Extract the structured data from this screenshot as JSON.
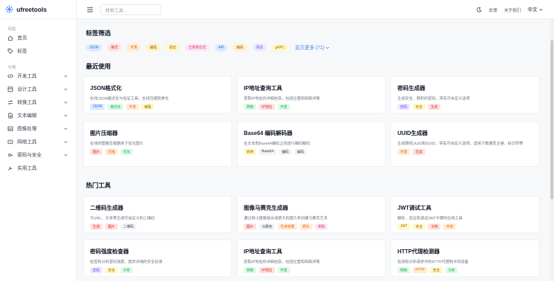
{
  "brand": {
    "name": "ufreetools"
  },
  "nav": {
    "section1_title": "导航",
    "section1_items": [
      {
        "label": "首页",
        "icon": "home-icon"
      },
      {
        "label": "标签",
        "icon": "tag-icon"
      }
    ],
    "section2_title": "分类",
    "section2_items": [
      {
        "label": "开发工具",
        "icon": "code-icon"
      },
      {
        "label": "设计工具",
        "icon": "palette-icon"
      },
      {
        "label": "转换工具",
        "icon": "swap-icon"
      },
      {
        "label": "文本编辑",
        "icon": "document-icon"
      },
      {
        "label": "图像处理",
        "icon": "image-icon"
      },
      {
        "label": "网络工具",
        "icon": "globe-icon"
      },
      {
        "label": "密码与安全",
        "icon": "shield-icon"
      },
      {
        "label": "实用工具",
        "icon": "wrench-icon"
      }
    ]
  },
  "topbar": {
    "search_placeholder": "搜索工具...",
    "feedback": "反馈",
    "about": "关于我们",
    "language": "中文"
  },
  "filter": {
    "title": "标签筛选",
    "tags": [
      {
        "label": "JSON",
        "bg": "#dbeafe",
        "fg": "#2563eb"
      },
      {
        "label": "格式",
        "bg": "#fee2e2",
        "fg": "#dc2626"
      },
      {
        "label": "开发",
        "bg": "#ffedd5",
        "fg": "#ea580c"
      },
      {
        "label": "编程",
        "bg": "#fef3c7",
        "fg": "#b45309"
      },
      {
        "label": "验证",
        "bg": "#fef9c3",
        "fg": "#a16207"
      },
      {
        "label": "正则表达式",
        "bg": "#fce7f3",
        "fg": "#db2777"
      },
      {
        "label": "API",
        "bg": "#dbeafe",
        "fg": "#2563eb"
      },
      {
        "label": "编码",
        "bg": "#fef3c7",
        "fg": "#b45309"
      },
      {
        "label": "测试",
        "bg": "#ede9fe",
        "fg": "#7c3aed"
      },
      {
        "label": "gRPC",
        "bg": "#fef9c3",
        "fg": "#a16207"
      }
    ],
    "show_more": "显示更多 (71)"
  },
  "recent": {
    "title": "最近使用",
    "cards": [
      {
        "title": "JSON格式化",
        "desc": "在线JSON格式化与验证工具，支持压缩和美化",
        "tags": [
          {
            "label": "JSON",
            "bg": "#dbeafe",
            "fg": "#2563eb"
          },
          {
            "label": "格式化",
            "bg": "#dcfce7",
            "fg": "#16a34a"
          },
          {
            "label": "开发",
            "bg": "#ffedd5",
            "fg": "#ea580c"
          },
          {
            "label": "编程",
            "bg": "#fef9c3",
            "fg": "#a16207"
          }
        ]
      },
      {
        "title": "IP地址查询工具",
        "desc": "获取IP地址的详细信息，包括位置和网络详情",
        "tags": [
          {
            "label": "网络",
            "bg": "#dcfce7",
            "fg": "#16a34a"
          },
          {
            "label": "IP地址",
            "bg": "#fee2e2",
            "fg": "#dc2626"
          },
          {
            "label": "开发",
            "bg": "#dcfce7",
            "fg": "#16a34a"
          }
        ]
      },
      {
        "title": "密码生成器",
        "desc": "生成安全、随机的密码，带有可自定义选项",
        "tags": [
          {
            "label": "密码",
            "bg": "#ede9fe",
            "fg": "#7c3aed"
          },
          {
            "label": "安全",
            "bg": "#fef9c3",
            "fg": "#a16207"
          },
          {
            "label": "生成",
            "bg": "#fee2e2",
            "fg": "#dc2626"
          }
        ]
      },
      {
        "title": "图片压缩器",
        "desc": "在线的图像压缩器用于优化图片",
        "tags": [
          {
            "label": "图片",
            "bg": "#fee2e2",
            "fg": "#dc2626"
          },
          {
            "label": "压缩",
            "bg": "#ffedd5",
            "fg": "#ea580c"
          },
          {
            "label": "优化",
            "bg": "#dcfce7",
            "fg": "#16a34a"
          }
        ]
      },
      {
        "title": "Base64 编码解码器",
        "desc": "在文本和Base64编码之间进行编码解码",
        "tags": [
          {
            "label": "转换",
            "bg": "#fef9c3",
            "fg": "#a16207"
          },
          {
            "label": "Base64",
            "bg": "#f3f4f6",
            "fg": "#374151"
          },
          {
            "label": "编码",
            "bg": "#f3f4f6",
            "fg": "#374151"
          },
          {
            "label": "解码",
            "bg": "#f3f4f6",
            "fg": "#374151"
          }
        ]
      },
      {
        "title": "UUID生成器",
        "desc": "生成随机UUID和GUID，带有可自定义选项，适用于数据库主键、标识符等",
        "tags": [
          {
            "label": "开发",
            "bg": "#ffedd5",
            "fg": "#ea580c"
          },
          {
            "label": "生成",
            "bg": "#fee2e2",
            "fg": "#dc2626"
          }
        ]
      }
    ]
  },
  "popular": {
    "title": "热门工具",
    "cards": [
      {
        "title": "二维码生成器",
        "desc": "为URL、文本等生成可自定义的二维码",
        "tags": [
          {
            "label": "生成",
            "bg": "#fee2e2",
            "fg": "#dc2626"
          },
          {
            "label": "图片",
            "bg": "#fee2e2",
            "fg": "#dc2626"
          },
          {
            "label": "二维码",
            "bg": "#f3f4f6",
            "fg": "#374151"
          }
        ]
      },
      {
        "title": "图像马赛克生成器",
        "desc": "通过将小图像组合成更大的图片来创建马赛克艺术",
        "tags": [
          {
            "label": "图片",
            "bg": "#fee2e2",
            "fg": "#dc2626"
          },
          {
            "label": "马赛克",
            "bg": "#f3f4f6",
            "fg": "#374151"
          },
          {
            "label": "艺术效果",
            "bg": "#ffedd5",
            "fg": "#ea580c"
          },
          {
            "label": "照片",
            "bg": "#ffedd5",
            "fg": "#ea580c"
          },
          {
            "label": "拼贴",
            "bg": "#fce7f3",
            "fg": "#db2777"
          }
        ]
      },
      {
        "title": "JWT调试工具",
        "desc": "解析、验证和调试JWT令牌的在线工具",
        "tags": [
          {
            "label": "JWT",
            "bg": "#fef9c3",
            "fg": "#a16207"
          },
          {
            "label": "安全",
            "bg": "#fef9c3",
            "fg": "#a16207"
          },
          {
            "label": "令牌",
            "bg": "#fee2e2",
            "fg": "#dc2626"
          },
          {
            "label": "开发",
            "bg": "#ffedd5",
            "fg": "#ea580c"
          }
        ]
      },
      {
        "title": "密码强度检查器",
        "desc": "检查和分析密码强度，提供详细的安全反馈",
        "tags": [
          {
            "label": "密码",
            "bg": "#ede9fe",
            "fg": "#7c3aed"
          },
          {
            "label": "安全",
            "bg": "#fef9c3",
            "fg": "#a16207"
          },
          {
            "label": "分析",
            "bg": "#dcfce7",
            "fg": "#16a34a"
          }
        ]
      },
      {
        "title": "IP地址查询工具",
        "desc": "获取IP地址的详细信息，包括位置和网络详情",
        "tags": [
          {
            "label": "网络",
            "bg": "#dcfce7",
            "fg": "#16a34a"
          },
          {
            "label": "IP地址",
            "bg": "#fee2e2",
            "fg": "#dc2626"
          },
          {
            "label": "开发",
            "bg": "#dcfce7",
            "fg": "#16a34a"
          }
        ]
      },
      {
        "title": "HTTP代理检测器",
        "desc": "检测和分析请求中的HTTP代理和中间设备",
        "tags": [
          {
            "label": "网络",
            "bg": "#dcfce7",
            "fg": "#16a34a"
          },
          {
            "label": "HTTP",
            "bg": "#ffedd5",
            "fg": "#ea580c"
          },
          {
            "label": "安全",
            "bg": "#fef9c3",
            "fg": "#a16207"
          },
          {
            "label": "分析",
            "bg": "#dcfce7",
            "fg": "#16a34a"
          }
        ]
      }
    ]
  }
}
